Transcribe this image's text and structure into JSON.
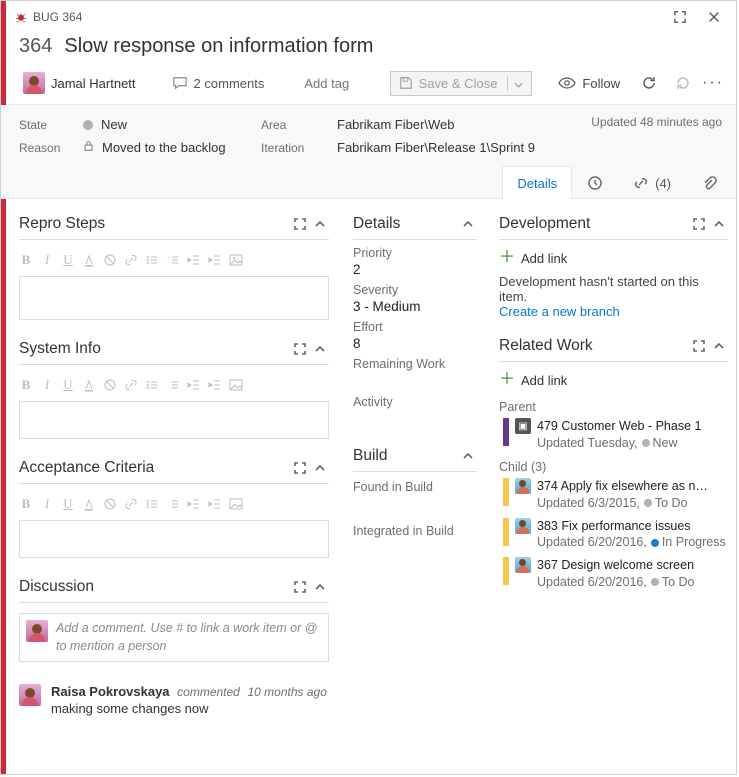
{
  "header": {
    "work_item_type": "BUG",
    "id": "364",
    "title": "Slow response on information form"
  },
  "toolbar": {
    "assignee": "Jamal Hartnett",
    "comments_count": "2 comments",
    "add_tag": "Add tag",
    "save_close": "Save & Close",
    "follow": "Follow"
  },
  "meta": {
    "state_label": "State",
    "state_value": "New",
    "reason_label": "Reason",
    "reason_value": "Moved to the backlog",
    "area_label": "Area",
    "area_value": "Fabrikam Fiber\\Web",
    "iteration_label": "Iteration",
    "iteration_value": "Fabrikam Fiber\\Release 1\\Sprint 9",
    "updated": "Updated 48 minutes ago"
  },
  "tabs": {
    "details": "Details",
    "links_count": "(4)"
  },
  "left": {
    "repro_title": "Repro Steps",
    "sysinfo_title": "System Info",
    "acceptance_title": "Acceptance Criteria",
    "discussion_title": "Discussion",
    "discussion_placeholder": "Add a comment. Use # to link a work item or @ to mention a person",
    "comment": {
      "author": "Raisa Pokrovskaya",
      "action": "commented",
      "when": "10 months ago",
      "text": "making some changes now"
    }
  },
  "mid": {
    "details_title": "Details",
    "priority_label": "Priority",
    "priority_value": "2",
    "severity_label": "Severity",
    "severity_value": "3 - Medium",
    "effort_label": "Effort",
    "effort_value": "8",
    "remaining_label": "Remaining Work",
    "remaining_value": "",
    "activity_label": "Activity",
    "activity_value": "",
    "build_title": "Build",
    "found_label": "Found in Build",
    "found_value": "",
    "integrated_label": "Integrated in Build",
    "integrated_value": ""
  },
  "right": {
    "dev_title": "Development",
    "add_link": "Add link",
    "dev_text": "Development hasn't started on this item.",
    "create_branch": "Create a new branch",
    "related_title": "Related Work",
    "parent_label": "Parent",
    "parent": {
      "id": "479",
      "title": "Customer Web - Phase 1",
      "sub": "Updated Tuesday,",
      "state": "New"
    },
    "child_label": "Child (3)",
    "children": [
      {
        "id": "374",
        "title": "Apply fix elsewhere as n…",
        "sub": "Updated 6/3/2015,",
        "state": "To Do",
        "state_cls": ""
      },
      {
        "id": "383",
        "title": "Fix performance issues",
        "sub": "Updated 6/20/2016,",
        "state": "In Progress",
        "state_cls": "blue"
      },
      {
        "id": "367",
        "title": "Design welcome screen",
        "sub": "Updated 6/20/2016,",
        "state": "To Do",
        "state_cls": ""
      }
    ]
  }
}
